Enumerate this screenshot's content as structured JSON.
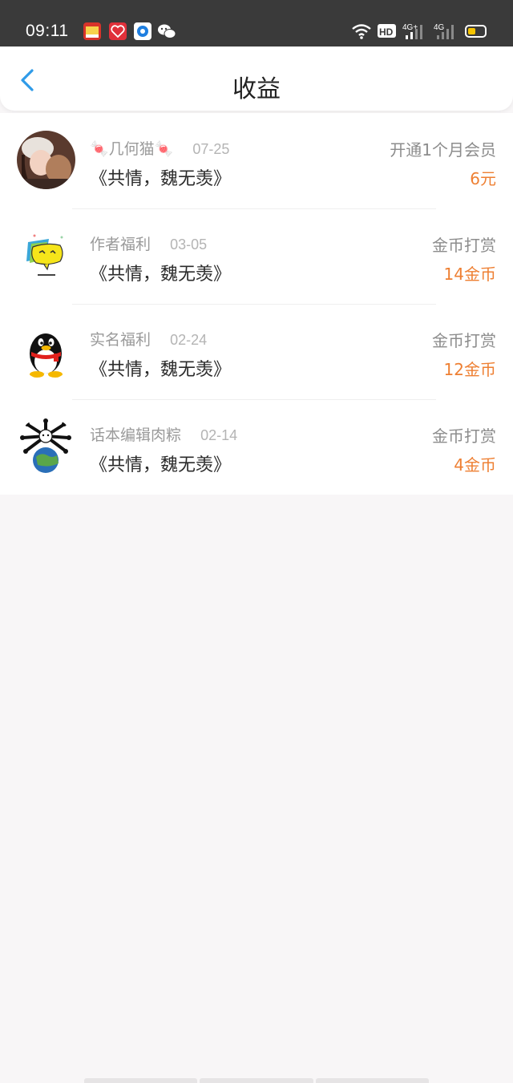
{
  "status_bar": {
    "time": "09:11",
    "battery_level": 0.45,
    "icons": [
      "app-notification-icon",
      "heart-app-icon",
      "blue-app-icon",
      "wechat-icon",
      "wifi-icon",
      "hd-icon",
      "signal-4g-plus-icon",
      "signal-4g-icon",
      "battery-icon"
    ]
  },
  "header": {
    "back_icon": "chevron-left-icon",
    "title": "收益",
    "accent_color": "#2f9be8"
  },
  "earnings": [
    {
      "avatar": "girl-photo-avatar",
      "name": "🍬几何猫🍬",
      "date": "07-25",
      "book": "《共情，魏无羡》",
      "type": "开通1个月会员",
      "amount": "6元"
    },
    {
      "avatar": "yellow-face-avatar",
      "name": "作者福利",
      "date": "03-05",
      "book": "《共情，魏无羡》",
      "type": "金币打赏",
      "amount": "14金币"
    },
    {
      "avatar": "qq-penguin-avatar",
      "name": "实名福利",
      "date": "02-24",
      "book": "《共情，魏无羡》",
      "type": "金币打赏",
      "amount": "12金币"
    },
    {
      "avatar": "bones-earth-avatar",
      "name": "话本编辑肉粽",
      "date": "02-14",
      "book": "《共情，魏无羡》",
      "type": "金币打赏",
      "amount": "4金币"
    }
  ],
  "colors": {
    "amount": "#ee7f32",
    "background": "#f8f6f7"
  }
}
